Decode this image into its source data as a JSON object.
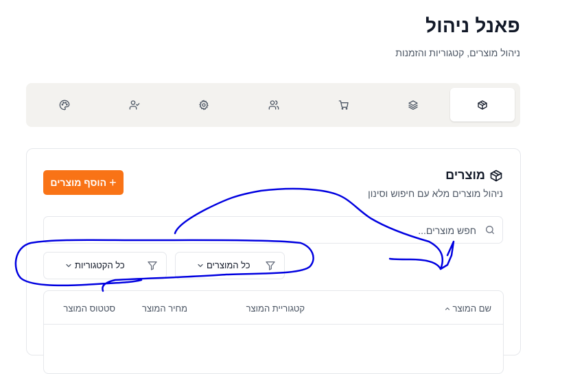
{
  "header": {
    "title": "פאנל ניהול",
    "subtitle": "ניהול מוצרים, קטגוריות והזמנות"
  },
  "tabs": [
    {
      "icon": "package-icon",
      "active": true
    },
    {
      "icon": "layers-icon",
      "active": false
    },
    {
      "icon": "cart-icon",
      "active": false
    },
    {
      "icon": "users-icon",
      "active": false
    },
    {
      "icon": "gear-icon",
      "active": false
    },
    {
      "icon": "user-check-icon",
      "active": false
    },
    {
      "icon": "palette-icon",
      "active": false
    }
  ],
  "products": {
    "title": "מוצרים",
    "subtitle": "ניהול מוצרים מלא עם חיפוש וסינון",
    "add_button": "הוסף מוצרים",
    "search_placeholder": "חפש מוצרים...",
    "filters": {
      "products_value": "כל המוצרים",
      "categories_value": "כל הקטגוריות"
    },
    "columns": {
      "name": "שם המוצר",
      "category": "קטגוריית המוצר",
      "price": "מחיר המוצר",
      "status": "סטטוס המוצר"
    }
  },
  "colors": {
    "accent": "#f97316",
    "tabbar_bg": "#f3f2ef",
    "annotation": "#0000e0"
  }
}
